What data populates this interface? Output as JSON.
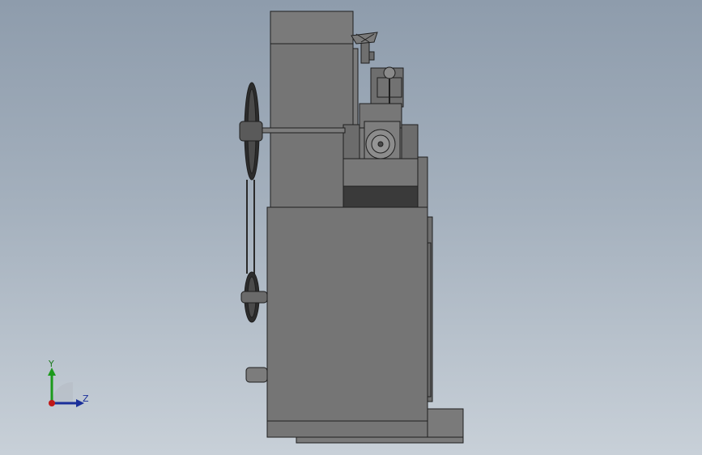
{
  "viewport": {
    "background_top": "#8e9cac",
    "background_bottom": "#c8d0d8"
  },
  "triad": {
    "y_label": "Y",
    "z_label": "Z",
    "y_color": "#1c9a1c",
    "z_color": "#1a2f9a",
    "x_color": "#c01818"
  },
  "model": {
    "body_color": "#757575",
    "edge_color": "#1e1e1e",
    "dark_band_color": "#3a3a3a"
  }
}
